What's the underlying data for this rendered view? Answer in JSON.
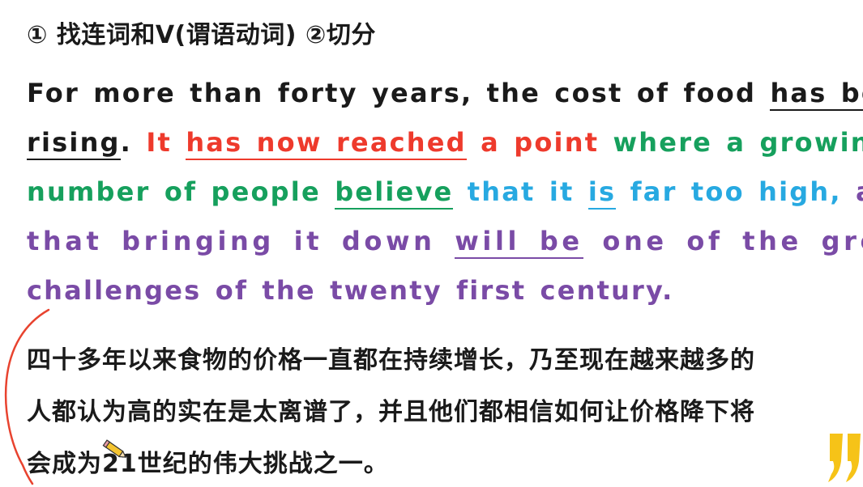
{
  "header": {
    "text": "① 找连词和V(谓语动词) ②切分"
  },
  "colors": {
    "black": "#1a1a1a",
    "red": "#ee3a2c",
    "green": "#16a05d",
    "blue": "#27a9e1",
    "purple": "#7a4ba6",
    "annotation_stroke": "#e8432f"
  },
  "english": {
    "line1": {
      "part1": "For more than forty years,  the cost of food ",
      "verb": "has been"
    },
    "line2": {
      "verb_end": "rising",
      "period": ". ",
      "red_it": "It ",
      "red_verb": "has now reached",
      "red_rest": " a point",
      "green": " where a growing"
    },
    "line3": {
      "green_start": "number of people ",
      "green_verb": "believe",
      "blue_start": " that it ",
      "blue_verb": "is",
      "blue_rest": " far too high,",
      "purple": " and"
    },
    "line4": {
      "purple_start": "that bringing it down ",
      "purple_verb": "will be",
      "purple_rest": " one of the greatest"
    },
    "line5": {
      "purple": "challenges of the twenty first century."
    }
  },
  "chinese": {
    "line1": "四十多年以来食物的价格一直都在持续增长，乃至现在越来越多的",
    "line2": "人都认为高的实在是太离谱了，并且他们都相信如何让价格降下将",
    "line3": "会成为21世纪的伟大挑战之一。"
  },
  "icons": {
    "pencil": "pencil-icon",
    "bracket": "hand-drawn-bracket",
    "quote": "yellow-quote-mark-icon"
  }
}
